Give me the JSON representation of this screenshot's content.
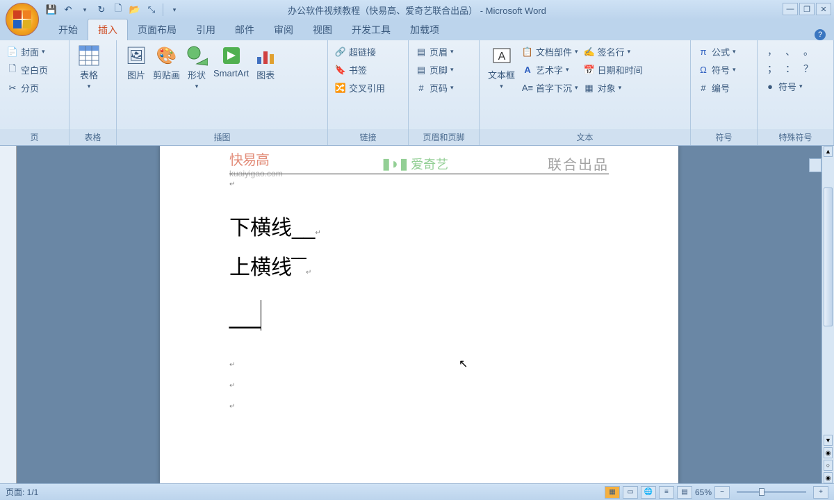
{
  "title": "办公软件视频教程（快易高、爱奇艺联合出品） - Microsoft Word",
  "qat": {
    "save": "💾",
    "undo": "↶",
    "redo": "↻",
    "new": "🗋",
    "open": "📂",
    "select": "⤡"
  },
  "tabs": [
    "开始",
    "插入",
    "页面布局",
    "引用",
    "邮件",
    "审阅",
    "视图",
    "开发工具",
    "加载项"
  ],
  "activeTab": 1,
  "groups": {
    "pages": {
      "label": "页",
      "cover": "封面",
      "blank": "空白页",
      "break": "分页"
    },
    "tables": {
      "label": "表格",
      "table": "表格"
    },
    "illustrations": {
      "label": "插图",
      "picture": "图片",
      "clipart": "剪贴画",
      "shapes": "形状",
      "smartart": "SmartArt",
      "chart": "图表"
    },
    "links": {
      "label": "链接",
      "hyperlink": "超链接",
      "bookmark": "书签",
      "crossref": "交叉引用"
    },
    "headerfooter": {
      "label": "页眉和页脚",
      "header": "页眉",
      "footer": "页脚",
      "pagenum": "页码"
    },
    "text": {
      "label": "文本",
      "textbox": "文本框",
      "parts": "文档部件",
      "wordart": "艺术字",
      "dropcap": "首字下沉",
      "signature": "签名行",
      "datetime": "日期和时间",
      "object": "对象"
    },
    "symbols": {
      "label": "符号",
      "equation": "公式",
      "symbol": "符号",
      "number": "编号"
    },
    "special": {
      "label": "特殊符号",
      "sym": "符号"
    }
  },
  "watermark": {
    "domain": "kuaiyigao.com",
    "brand2": "爱奇艺",
    "text": "联合出品"
  },
  "document": {
    "line1": "下横线__",
    "line2": "上横线‾‾",
    "line3": "__"
  },
  "status": {
    "page": "页面: 1/1",
    "zoom": "65%"
  }
}
